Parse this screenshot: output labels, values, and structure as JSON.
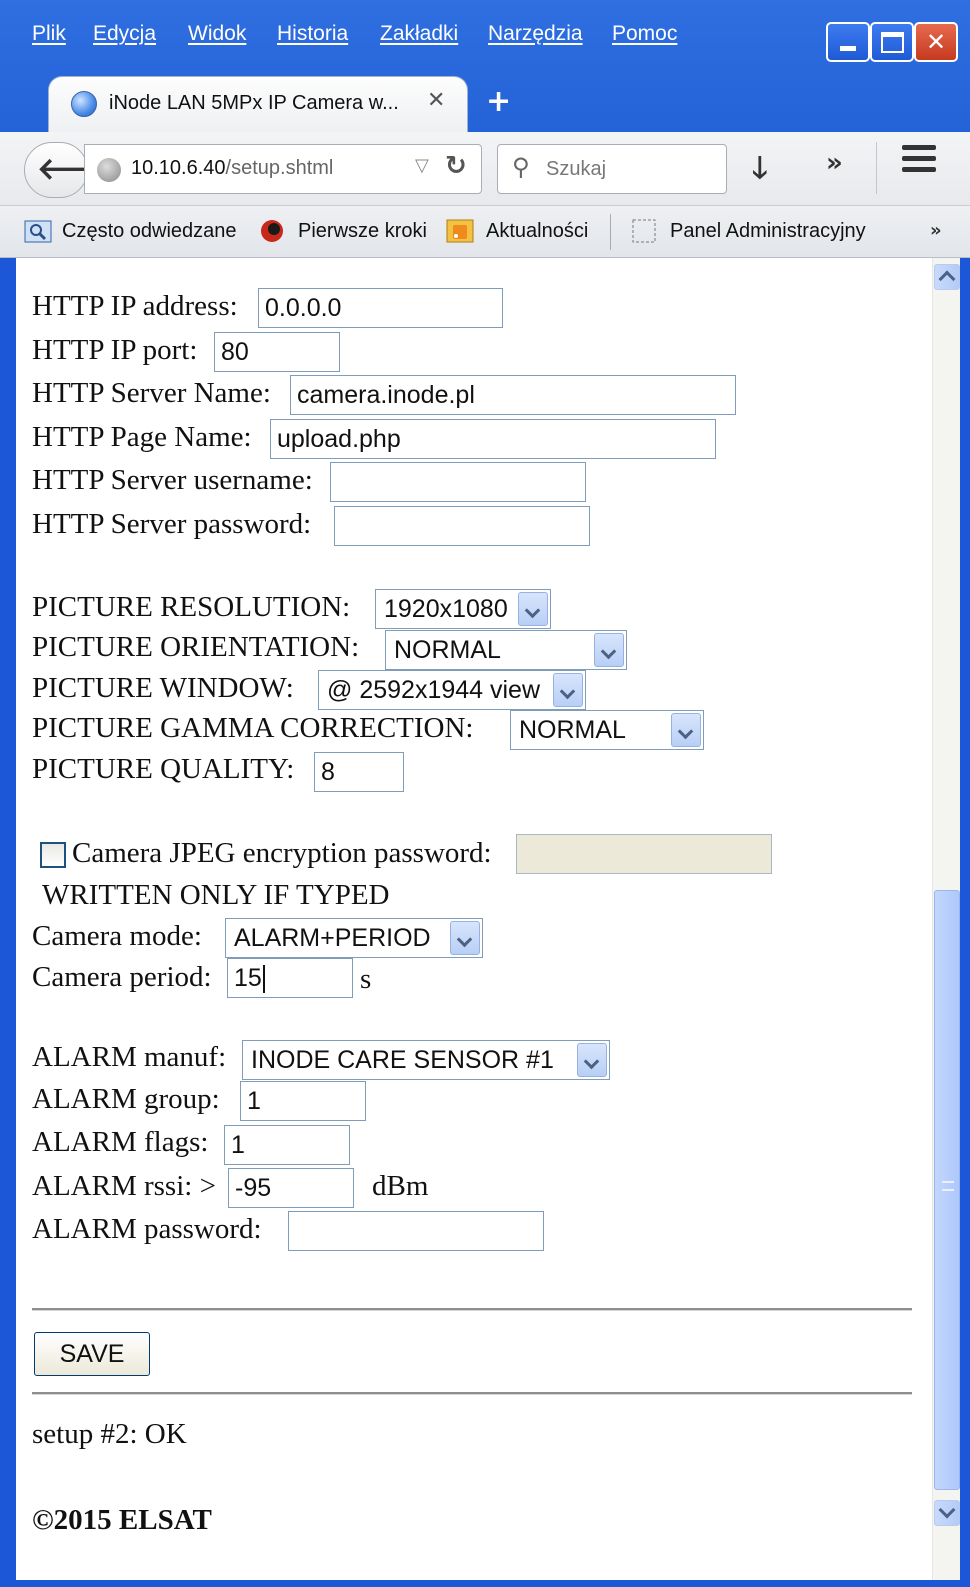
{
  "window": {
    "menu": [
      "Plik",
      "Edycja",
      "Widok",
      "Historia",
      "Zakładki",
      "Narzędzia",
      "Pomoc"
    ],
    "controls": {
      "minimize": "minimize",
      "maximize": "maximize",
      "close": "✕"
    }
  },
  "tab": {
    "title": "iNode LAN 5MPx IP Camera w...",
    "close": "✕",
    "new": "+"
  },
  "navbar": {
    "url_host": "10.10.6.40",
    "url_path": "/setup.shtml",
    "search_placeholder": "Szukaj"
  },
  "bookmarks": [
    "Często odwiedzane",
    "Pierwsze kroki",
    "Aktualności",
    "Panel Administracyjny"
  ],
  "form": {
    "http": {
      "ip_label": "HTTP IP address:",
      "ip_value": "0.0.0.0",
      "port_label": "HTTP IP port:",
      "port_value": "80",
      "server_label": "HTTP Server Name:",
      "server_value": "camera.inode.pl",
      "page_label": "HTTP Page Name:",
      "page_value": "upload.php",
      "user_label": "HTTP Server username:",
      "user_value": "",
      "pass_label": "HTTP Server password:",
      "pass_value": ""
    },
    "picture": {
      "resolution_label": "PICTURE RESOLUTION:",
      "resolution_value": "1920x1080",
      "orientation_label": "PICTURE ORIENTATION:",
      "orientation_value": "NORMAL",
      "window_label": "PICTURE WINDOW:",
      "window_value": "@ 2592x1944 view",
      "gamma_label": "PICTURE GAMMA CORRECTION:",
      "gamma_value": "NORMAL",
      "quality_label": "PICTURE QUALITY:",
      "quality_value": "8"
    },
    "camera": {
      "encryption_label": "Camera JPEG encryption password:",
      "encryption_checked": false,
      "encryption_value": "",
      "written_note": "WRITTEN ONLY IF TYPED",
      "mode_label": "Camera mode:",
      "mode_value": "ALARM+PERIOD",
      "period_label": "Camera period:",
      "period_value": "15",
      "period_unit": "s"
    },
    "alarm": {
      "manuf_label": "ALARM manuf:",
      "manuf_value": "INODE CARE SENSOR #1",
      "group_label": "ALARM group:",
      "group_value": "1",
      "flags_label": "ALARM flags:",
      "flags_value": "1",
      "rssi_label": "ALARM rssi: >",
      "rssi_value": "-95",
      "rssi_unit": "dBm",
      "password_label": "ALARM password:",
      "password_value": ""
    },
    "save_label": "SAVE",
    "status": "setup #2: OK",
    "footer": "©2015 ELSAT"
  }
}
